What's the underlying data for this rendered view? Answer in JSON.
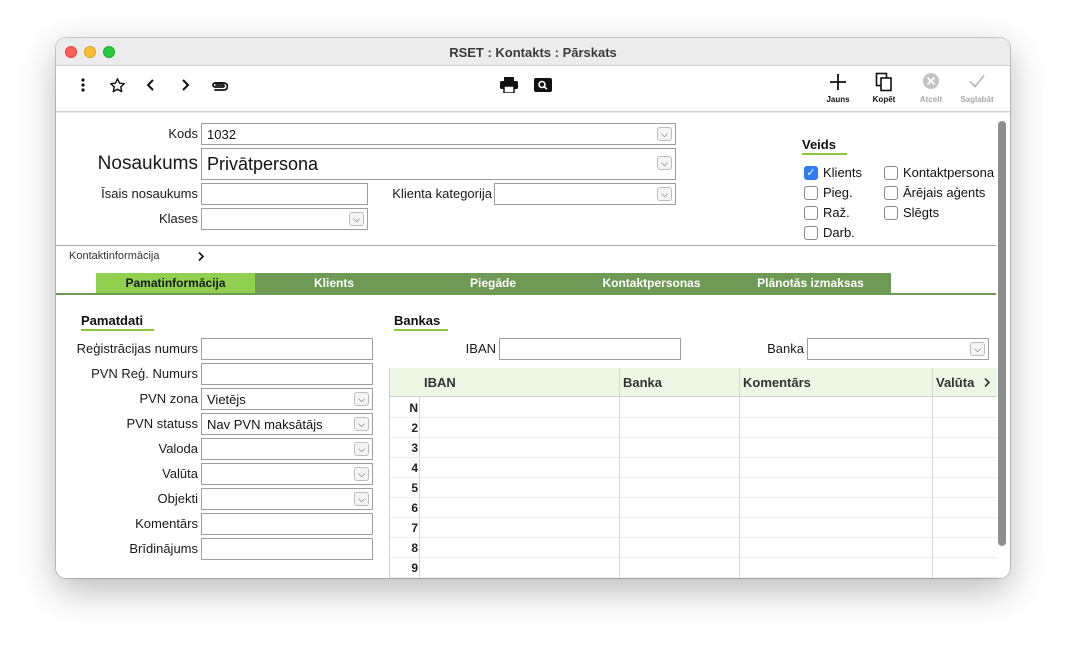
{
  "window": {
    "title": "RSET : Kontakts : Pārskats"
  },
  "toolbar": {
    "left_icons": [
      "more-vertical-icon",
      "star-icon",
      "chevron-left-icon",
      "chevron-right-icon",
      "paperclip-icon"
    ],
    "center_icons": [
      "printer-icon",
      "search-icon"
    ],
    "buttons": [
      {
        "label": "Jauns",
        "icon": "plus-icon"
      },
      {
        "label": "Kopēt",
        "icon": "copy-icon"
      },
      {
        "label": "Atcelt",
        "icon": "cancel-icon"
      },
      {
        "label": "Saglabāt",
        "icon": "checkmark-icon"
      }
    ]
  },
  "header": {
    "kods_label": "Kods",
    "kods_value": "1032",
    "nosaukums_label": "Nosaukums",
    "nosaukums_value": "Privātpersona",
    "isais_label": "Īsais nosaukums",
    "isais_value": "",
    "kategorija_label": "Klienta kategorija",
    "kategorija_value": "",
    "klases_label": "Klases",
    "klases_value": ""
  },
  "veids": {
    "title": "Veids",
    "options": [
      {
        "label": "Klients",
        "checked": true
      },
      {
        "label": "Pieg.",
        "checked": false
      },
      {
        "label": "Raž.",
        "checked": false
      },
      {
        "label": "Darb.",
        "checked": false
      },
      {
        "label": "Kontaktpersona",
        "checked": false
      },
      {
        "label": "Ārējais aģents",
        "checked": false
      },
      {
        "label": "Slēgts",
        "checked": false
      }
    ]
  },
  "kontaktinfo": {
    "label": "Kontaktinformācija"
  },
  "tabs": [
    {
      "label": "Pamatinformācija",
      "active": true
    },
    {
      "label": "Klients",
      "active": false
    },
    {
      "label": "Piegāde",
      "active": false
    },
    {
      "label": "Kontaktpersonas",
      "active": false
    },
    {
      "label": "Plānotās izmaksas",
      "active": false
    }
  ],
  "pamatdati": {
    "title": "Pamatdati",
    "fields": [
      {
        "label": "Reģistrācijas numurs",
        "value": "",
        "select": false
      },
      {
        "label": "PVN Reģ. Numurs",
        "value": "",
        "select": false
      },
      {
        "label": "PVN zona",
        "value": "Vietējs",
        "select": true
      },
      {
        "label": "PVN statuss",
        "value": "Nav PVN maksātājs",
        "select": true
      },
      {
        "label": "Valoda",
        "value": "",
        "select": true
      },
      {
        "label": "Valūta",
        "value": "",
        "select": true
      },
      {
        "label": "Objekti",
        "value": "",
        "select": true
      },
      {
        "label": "Komentārs",
        "value": "",
        "select": false
      },
      {
        "label": "Brīdinājums",
        "value": "",
        "select": false
      }
    ]
  },
  "bankas": {
    "title": "Bankas",
    "iban_label": "IBAN",
    "iban_value": "",
    "banka_label": "Banka",
    "banka_value": "",
    "columns": [
      "IBAN",
      "Banka",
      "Komentārs",
      "Valūta"
    ],
    "rows": [
      "N",
      "2",
      "3",
      "4",
      "5",
      "6",
      "7",
      "8",
      "9"
    ]
  }
}
